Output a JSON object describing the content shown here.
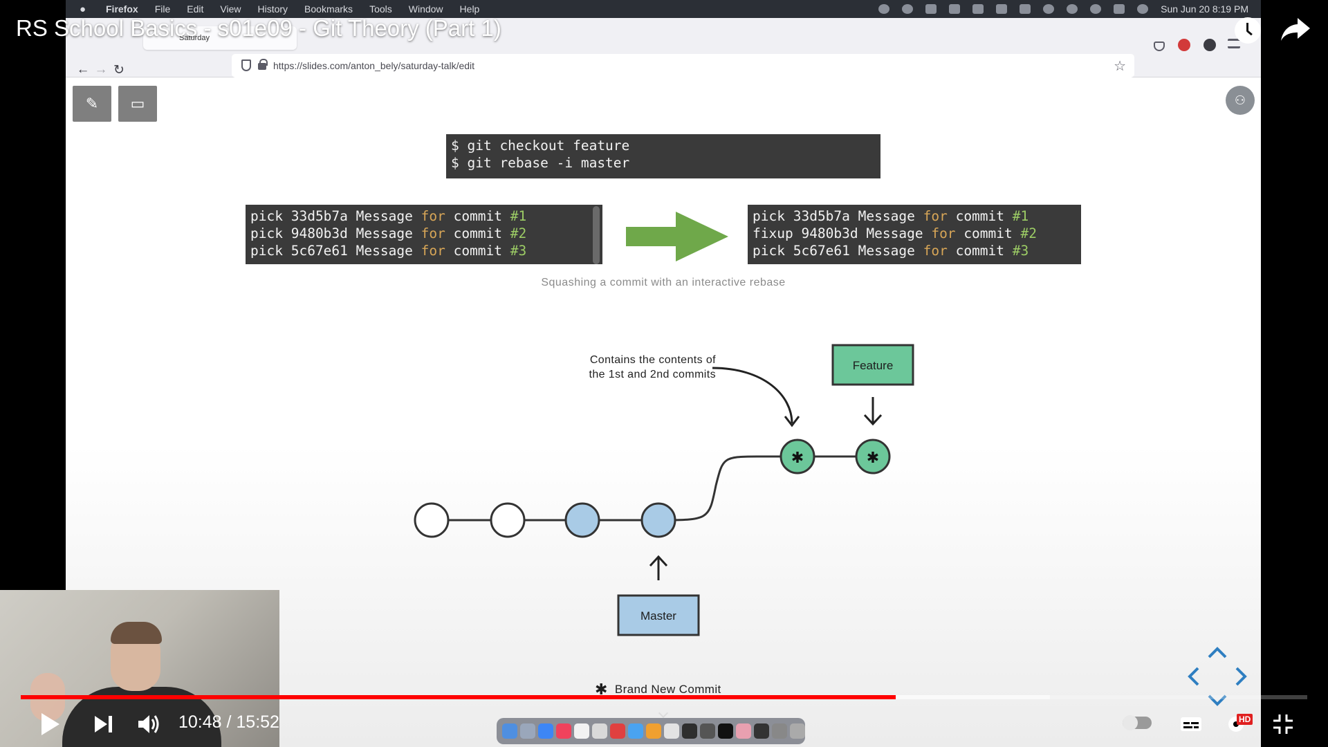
{
  "video": {
    "title": "RS School Basics - s01e09 - Git Theory (Part 1)",
    "current_time": "10:48",
    "duration": "15:52",
    "time_display": "10:48 / 15:52",
    "progress_fraction": 0.68,
    "buffer_fraction": 0.8,
    "hd_badge": "HD"
  },
  "mac_menubar": {
    "app": "Firefox",
    "menus": [
      "File",
      "Edit",
      "View",
      "History",
      "Bookmarks",
      "Tools",
      "Window",
      "Help"
    ],
    "datetime": "Sun Jun 20  8:19 PM"
  },
  "browser": {
    "tab_title": "Saturday",
    "url_host": "https://slides.com",
    "url_path": "/anton_bely/saturday-talk/edit"
  },
  "slide": {
    "command_block": [
      "$ git checkout feature",
      "$ git rebase -i master"
    ],
    "before_block": [
      {
        "cmd": "pick",
        "hash": "33d5b7a",
        "msg": "Message",
        "kw": "for",
        "word": "commit",
        "num": "#1"
      },
      {
        "cmd": "pick",
        "hash": "9480b3d",
        "msg": "Message",
        "kw": "for",
        "word": "commit",
        "num": "#2"
      },
      {
        "cmd": "pick",
        "hash": "5c67e61",
        "msg": "Message",
        "kw": "for",
        "word": "commit",
        "num": "#3"
      }
    ],
    "after_block": [
      {
        "cmd": "pick",
        "hash": "33d5b7a",
        "msg": "Message",
        "kw": "for",
        "word": "commit",
        "num": "#1"
      },
      {
        "cmd": "fixup",
        "hash": "9480b3d",
        "msg": "Message",
        "kw": "for",
        "word": "commit",
        "num": "#2"
      },
      {
        "cmd": "pick",
        "hash": "5c67e61",
        "msg": "Message",
        "kw": "for",
        "word": "commit",
        "num": "#3"
      }
    ],
    "caption": "Squashing a commit with an interactive rebase",
    "annotation_line1": "Contains the contents of",
    "annotation_line2": "the 1st and 2nd commits",
    "feature_label": "Feature",
    "master_label": "Master",
    "legend_label": "Brand New Commit"
  },
  "colors": {
    "accent_red": "#ff0000",
    "feature_green": "#6cc79a",
    "master_blue": "#a9cbe6",
    "arrow_green": "#6fa84a",
    "code_bg": "#3a3a3a"
  }
}
